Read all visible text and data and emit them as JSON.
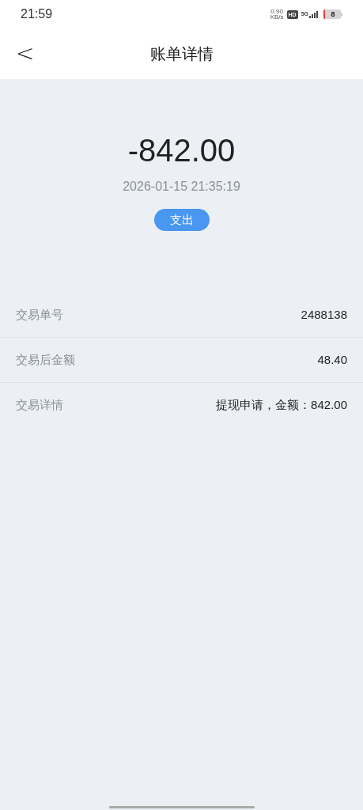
{
  "status_bar": {
    "time": "21:59",
    "speed_value": "0.90",
    "speed_unit": "KB/s",
    "hd": "HD",
    "network": "5G",
    "battery": "8"
  },
  "header": {
    "back": "<",
    "title": "账单详情"
  },
  "summary": {
    "amount": "-842.00",
    "datetime": "2026-01-15 21:35:19",
    "type_badge": "支出"
  },
  "details": [
    {
      "label": "交易单号",
      "value": "2488138"
    },
    {
      "label": "交易后金额",
      "value": "48.40"
    },
    {
      "label": "交易详情",
      "value": "提现申请，金额：842.00"
    }
  ]
}
